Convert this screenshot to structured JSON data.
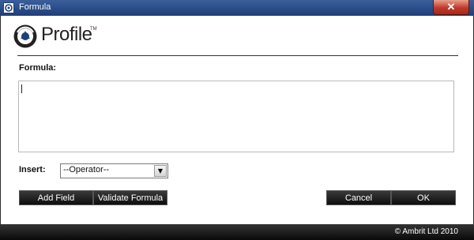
{
  "window": {
    "title": "Formula",
    "close_label": "✕"
  },
  "logo": {
    "text": "Profile",
    "tm": "TM",
    "colors": {
      "ring": "#1d3f7a",
      "center": "#2f5fa6",
      "dark": "#222222"
    }
  },
  "form": {
    "formula_label": "Formula:",
    "formula_value": "",
    "insert_label": "Insert:",
    "insert_selected": "--Operator--"
  },
  "buttons": {
    "add_field": "Add Field",
    "validate_formula": "Validate Formula",
    "cancel": "Cancel",
    "ok": "OK"
  },
  "footer": {
    "copyright": "© Ambrit Ltd 2010"
  },
  "colors": {
    "titlebar": "#2a4f8c",
    "button_bg": "#1a1a1a",
    "footer_bg": "#111111"
  }
}
